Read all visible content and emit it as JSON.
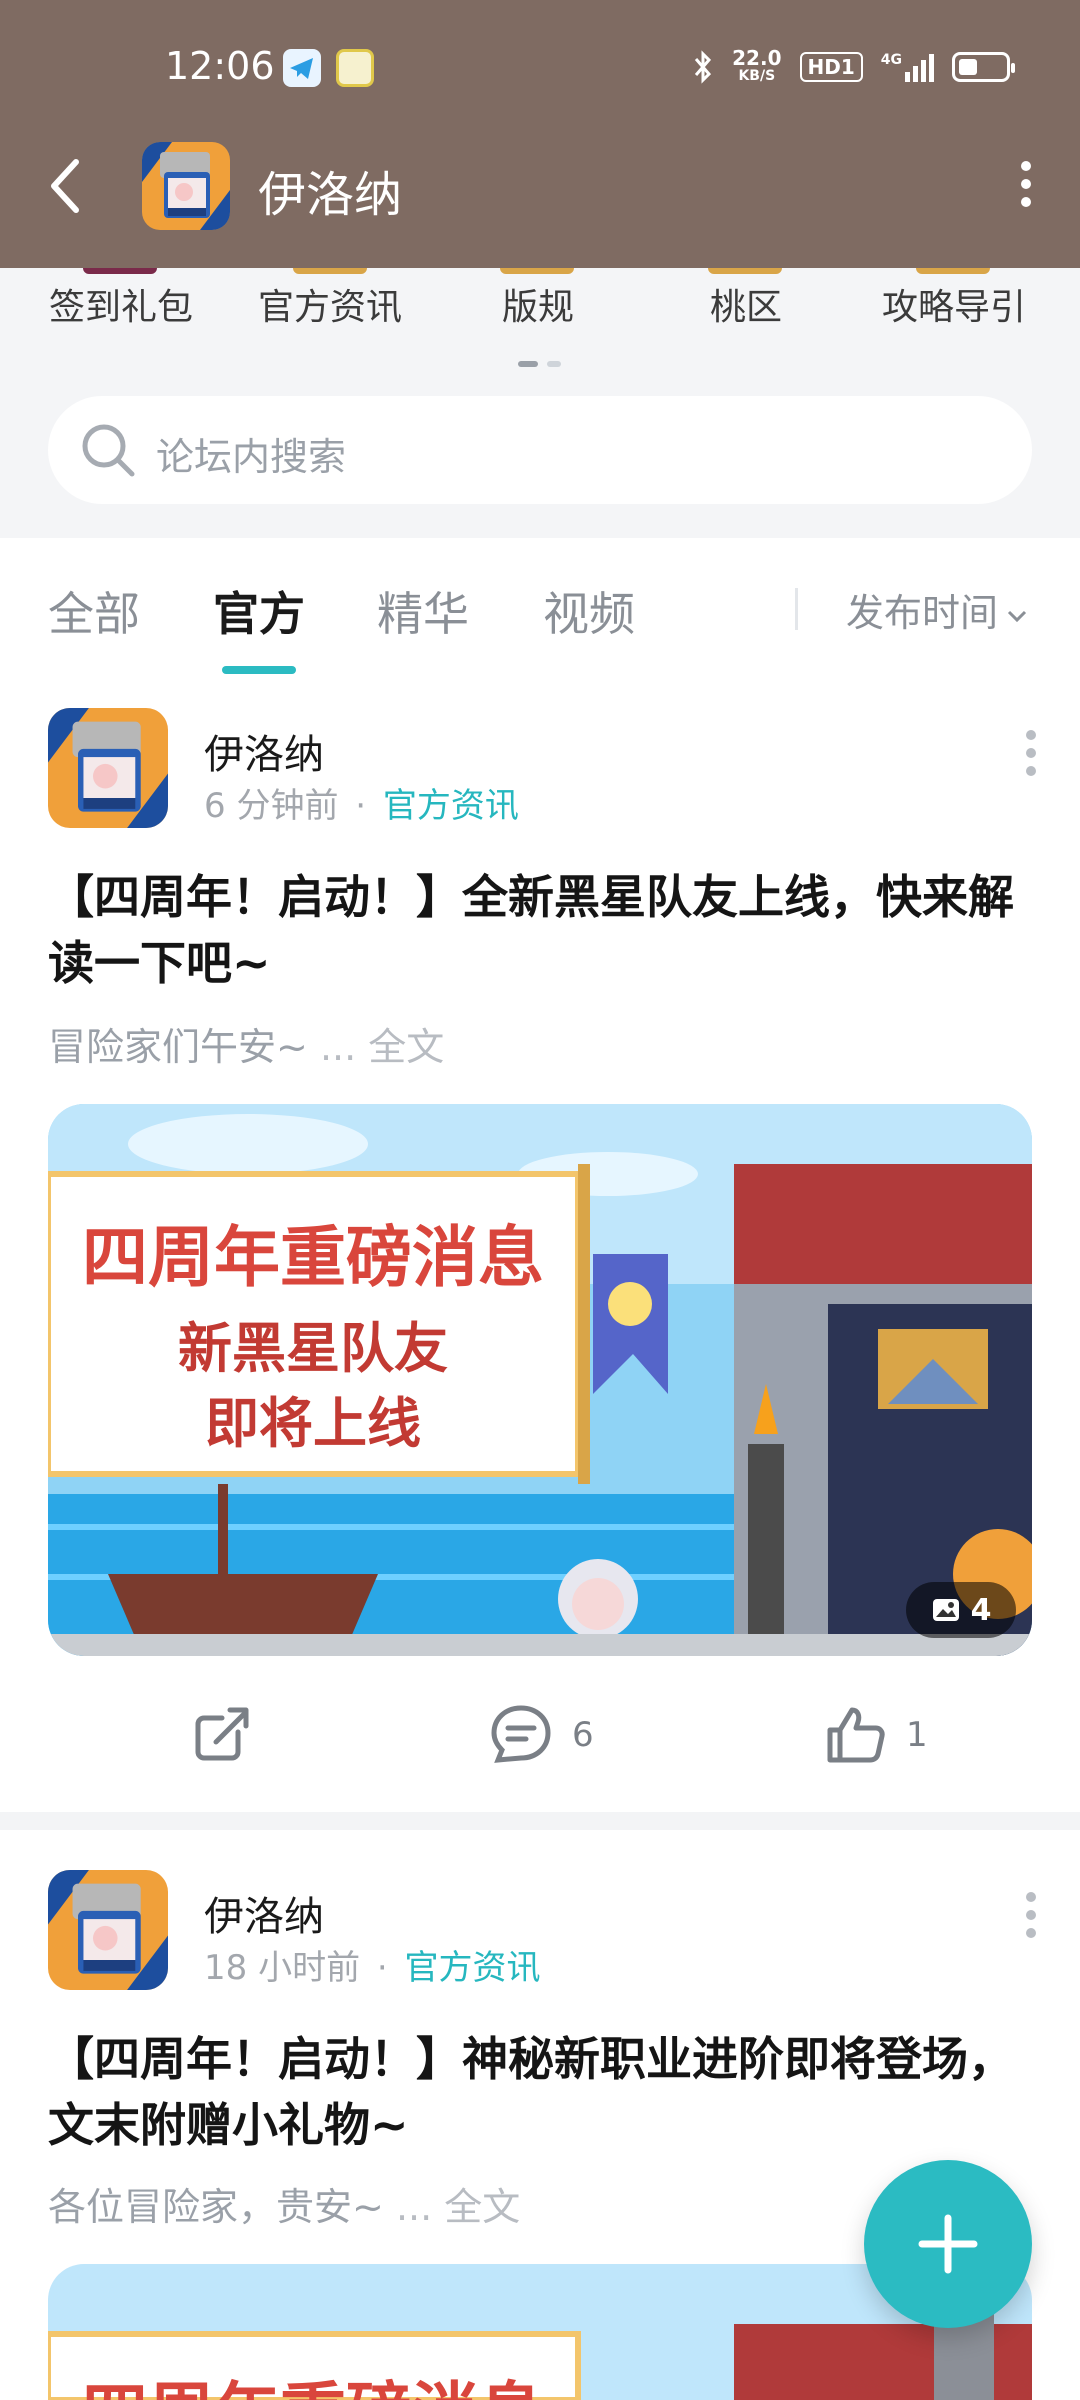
{
  "status_bar": {
    "time": "12:06",
    "net_speed_value": "22.0",
    "net_speed_unit": "KB/S",
    "hd_label": "HD1",
    "network_label": "4G"
  },
  "app_bar": {
    "title": "伊洛纳"
  },
  "shortcuts": {
    "items": [
      {
        "label": "签到礼包"
      },
      {
        "label": "官方资讯"
      },
      {
        "label": "版规"
      },
      {
        "label": "桃区"
      },
      {
        "label": "攻略导引"
      }
    ]
  },
  "search": {
    "placeholder": "论坛内搜索"
  },
  "tabs": {
    "items": [
      {
        "label": "全部"
      },
      {
        "label": "官方"
      },
      {
        "label": "精华"
      },
      {
        "label": "视频"
      }
    ],
    "active_index": 1,
    "sort_label": "发布时间"
  },
  "posts": [
    {
      "author": "伊洛纳",
      "time": "6 分钟前",
      "separator": "·",
      "category": "官方资讯",
      "title": "【四周年！启动！】全新黑星队友上线，快来解读一下吧~",
      "excerpt": "冒险家们午安~",
      "ellipsis": "...",
      "full_text": "全文",
      "image_text_1": "四周年重磅消息",
      "image_text_2": "新黑星队友",
      "image_text_3": "即将上线",
      "image_count": "4",
      "comments": "6",
      "likes": "1"
    },
    {
      "author": "伊洛纳",
      "time": "18 小时前",
      "separator": "·",
      "category": "官方资讯",
      "title": "【四周年！启动！】神秘新职业进阶即将登场，文末附赠小礼物~",
      "excerpt": "各位冒险家，贵安~",
      "ellipsis": "...",
      "full_text": "全文",
      "image_text_1": "四周年重磅消息"
    }
  ],
  "colors": {
    "header_bg": "#7f6b62",
    "accent": "#2bbbc2",
    "banner_title": "#d9463c",
    "sea": "#2aa7e6"
  }
}
